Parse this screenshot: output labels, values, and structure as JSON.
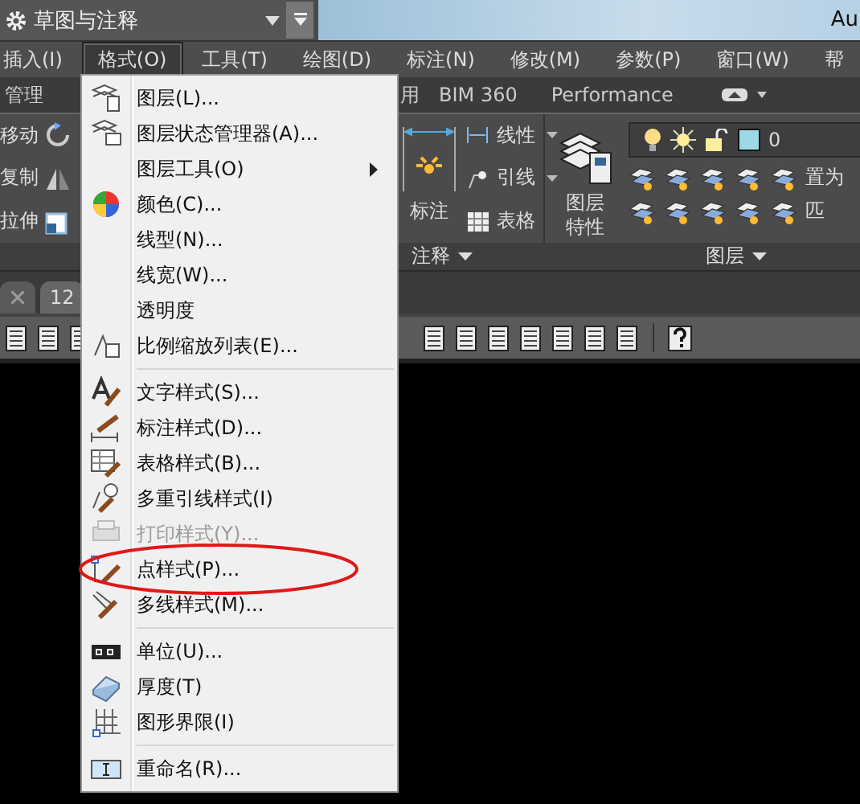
{
  "quick_access": {
    "workspace": "草图与注释"
  },
  "app_title": "Au",
  "menu_bar": [
    {
      "label": "插入(I)",
      "selected": false
    },
    {
      "label": "格式(O)",
      "selected": true
    },
    {
      "label": "工具(T)",
      "selected": false
    },
    {
      "label": "绘图(D)",
      "selected": false
    },
    {
      "label": "标注(N)",
      "selected": false
    },
    {
      "label": "修改(M)",
      "selected": false
    },
    {
      "label": "参数(P)",
      "selected": false
    },
    {
      "label": "窗口(W)",
      "selected": false
    },
    {
      "label": "帮",
      "selected": false
    }
  ],
  "ribbon_tabs": [
    {
      "label": "管理"
    },
    {
      "label": "用"
    },
    {
      "label": "BIM 360"
    },
    {
      "label": "Performance"
    }
  ],
  "ribbon": {
    "modify_tools": [
      "移动",
      "复制",
      "拉伸"
    ],
    "annotation": {
      "big_tool": "标注",
      "tools": [
        "线性",
        "引线",
        "表格"
      ],
      "panel_title": "注释"
    },
    "layers": {
      "big_tool": "图层特性",
      "current_layer": "0",
      "tools": [
        "置为",
        "匹"
      ],
      "panel_title": "图层"
    }
  },
  "file_tabs": [
    {
      "label": "12"
    }
  ],
  "format_menu": {
    "items": [
      {
        "kind": "item",
        "label": "图层(L)...",
        "disabled": false,
        "submenu": false,
        "highlighted": false
      },
      {
        "kind": "item",
        "label": "图层状态管理器(A)...",
        "disabled": false,
        "submenu": false,
        "highlighted": false
      },
      {
        "kind": "item",
        "label": "图层工具(O)",
        "disabled": false,
        "submenu": true,
        "highlighted": false
      },
      {
        "kind": "item",
        "label": "颜色(C)...",
        "disabled": false,
        "submenu": false,
        "highlighted": false
      },
      {
        "kind": "item",
        "label": "线型(N)...",
        "disabled": false,
        "submenu": false,
        "highlighted": false
      },
      {
        "kind": "item",
        "label": "线宽(W)...",
        "disabled": false,
        "submenu": false,
        "highlighted": false
      },
      {
        "kind": "item",
        "label": "透明度",
        "disabled": false,
        "submenu": false,
        "highlighted": false
      },
      {
        "kind": "item",
        "label": "比例缩放列表(E)...",
        "disabled": false,
        "submenu": false,
        "highlighted": false
      },
      {
        "kind": "separator"
      },
      {
        "kind": "item",
        "label": "文字样式(S)...",
        "disabled": false,
        "submenu": false,
        "highlighted": false
      },
      {
        "kind": "item",
        "label": "标注样式(D)...",
        "disabled": false,
        "submenu": false,
        "highlighted": false
      },
      {
        "kind": "item",
        "label": "表格样式(B)...",
        "disabled": false,
        "submenu": false,
        "highlighted": false
      },
      {
        "kind": "item",
        "label": "多重引线样式(I)",
        "disabled": false,
        "submenu": false,
        "highlighted": false
      },
      {
        "kind": "item",
        "label": "打印样式(Y)...",
        "disabled": true,
        "submenu": false,
        "highlighted": false
      },
      {
        "kind": "item",
        "label": "点样式(P)...",
        "disabled": false,
        "submenu": false,
        "highlighted": true
      },
      {
        "kind": "item",
        "label": "多线样式(M)...",
        "disabled": false,
        "submenu": false,
        "highlighted": false
      },
      {
        "kind": "separator"
      },
      {
        "kind": "item",
        "label": "单位(U)...",
        "disabled": false,
        "submenu": false,
        "highlighted": false
      },
      {
        "kind": "item",
        "label": "厚度(T)",
        "disabled": false,
        "submenu": false,
        "highlighted": false
      },
      {
        "kind": "item",
        "label": "图形界限(I)",
        "disabled": false,
        "submenu": false,
        "highlighted": false
      },
      {
        "kind": "separator"
      },
      {
        "kind": "item",
        "label": "重命名(R)...",
        "disabled": false,
        "submenu": false,
        "highlighted": false
      }
    ]
  }
}
